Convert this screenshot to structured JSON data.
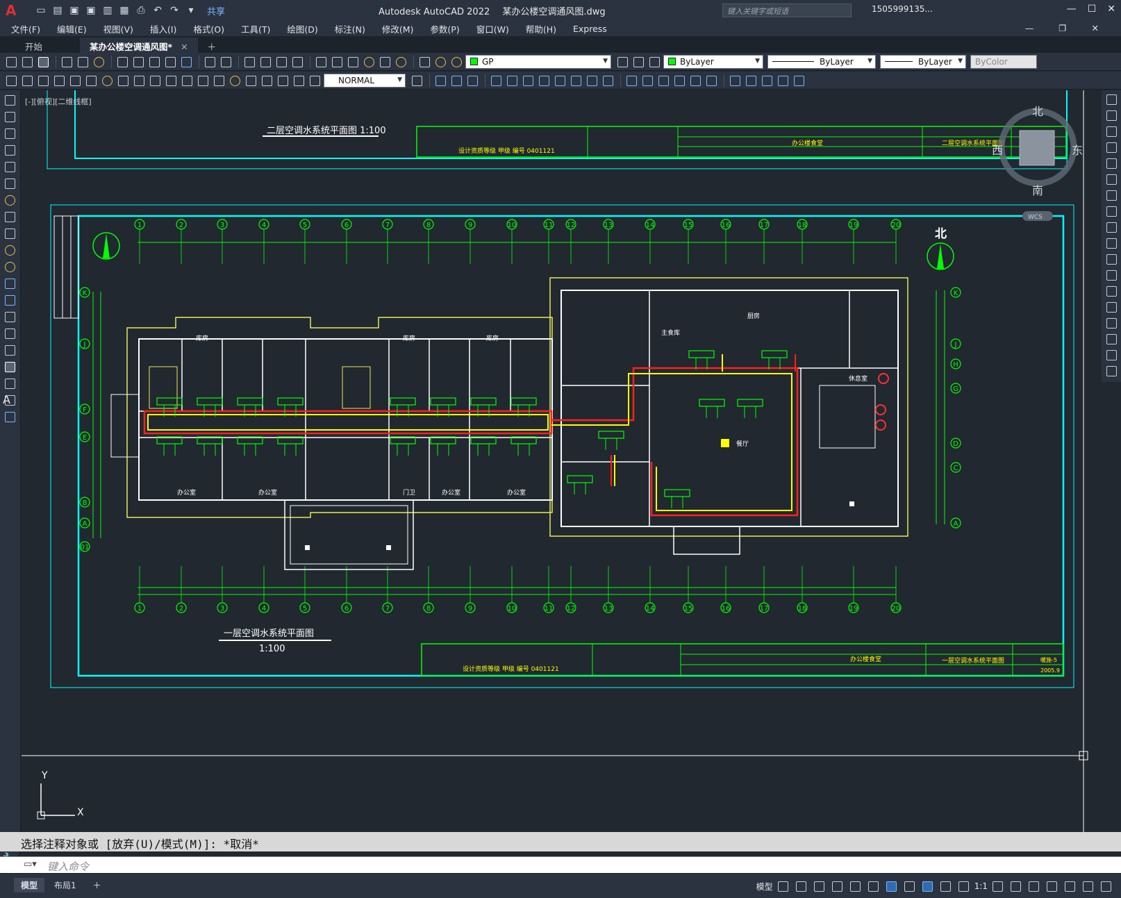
{
  "window": {
    "app_title": "Autodesk AutoCAD 2022",
    "file_name": "某办公楼空调通风图.dwg",
    "share_label": "共享",
    "search_placeholder": "键入关键字或短语",
    "user": "1505999135...",
    "logo": "A"
  },
  "menu": [
    "文件(F)",
    "编辑(E)",
    "视图(V)",
    "插入(I)",
    "格式(O)",
    "工具(T)",
    "绘图(D)",
    "标注(N)",
    "修改(M)",
    "参数(P)",
    "窗口(W)",
    "帮助(H)",
    "Express"
  ],
  "tabs": [
    {
      "label": "开始"
    },
    {
      "label": "某办公楼空调通风图*"
    }
  ],
  "toolbar": {
    "layer": "GP",
    "color": "ByLayer",
    "linetype": "ByLayer",
    "lineweight": "ByLayer",
    "plotstyle": "ByColor",
    "dimstyle": "NORMAL"
  },
  "viewport_label": "[-][俯视][二维线框]",
  "viewcube": {
    "north": "北",
    "south": "南",
    "west": "西",
    "east": "东",
    "wcs": "WCS"
  },
  "drawing": {
    "upper_title": "二层空调水系统平面图  1:100",
    "lower_title": "一层空调水系统平面图",
    "lower_scale": "1:100",
    "north_label": "北",
    "grid_cols": [
      "1",
      "2",
      "3",
      "4",
      "5",
      "6",
      "7",
      "8",
      "9",
      "10",
      "11",
      "12",
      "13",
      "14",
      "15",
      "16",
      "17",
      "18",
      "19",
      "20"
    ],
    "grid_rows_left": [
      "K",
      "J",
      "F",
      "E",
      "B",
      "A",
      "01"
    ],
    "grid_rows_right": [
      "K",
      "J",
      "H",
      "G",
      "D",
      "C",
      "A"
    ],
    "titleblock": {
      "design_grade": "设计资质等级   甲级      编号   0401121",
      "project": "办公楼食堂",
      "upper_drawing_name": "二层空调水系统平面图",
      "lower_drawing_name": "一层空调水系统平面图",
      "lower_no": "暖施-5",
      "date": "2005.9"
    },
    "rooms": [
      "办公室",
      "办公室",
      "门卫",
      "办公室",
      "办公室",
      "库房",
      "库房",
      "库房",
      "餐厅",
      "厨房",
      "主食库",
      "休息室"
    ],
    "ucs": {
      "x": "X",
      "y": "Y"
    }
  },
  "command": {
    "history": "选择注释对象或 [放弃(U)/模式(M)]: *取消*",
    "placeholder": "键入命令"
  },
  "status": {
    "layout_tabs": [
      "模型",
      "布局1"
    ],
    "model": "模型",
    "scale": "1:1"
  }
}
